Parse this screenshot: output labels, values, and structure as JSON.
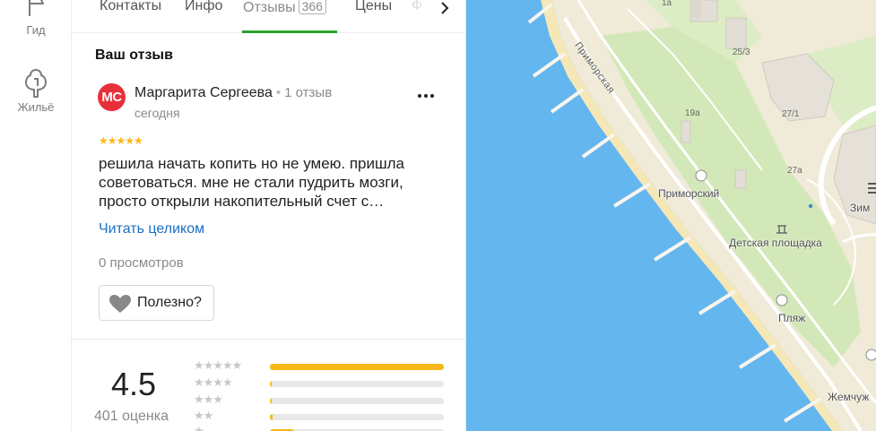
{
  "sidebar": {
    "guide_label": "Гид",
    "housing_label": "Жильё"
  },
  "tabs": [
    {
      "label": "Контакты"
    },
    {
      "label": "Инфо"
    },
    {
      "label": "Отзывы",
      "badge": "366",
      "active": true
    },
    {
      "label": "Цены"
    },
    {
      "label": "Ф"
    }
  ],
  "review": {
    "section_title": "Ваш отзыв",
    "avatar_initials": "МС",
    "author": "Маргарита Сергеева",
    "author_reviews": "1 отзыв",
    "date": "сегодня",
    "stars": "★★★★★",
    "text": "решила начать копить но не умею. пришла советоваться. мне не стали пудрить мозги, просто открыли накопительный счет с…",
    "read_full": "Читать целиком",
    "views": "0 просмотров",
    "useful_label": "Полезно?"
  },
  "rating": {
    "value": "4.5",
    "count": "401 оценка",
    "distribution": [
      {
        "stars": "★★★★★",
        "fraction": 1.0
      },
      {
        "stars": "★★★★",
        "fraction": 0.01
      },
      {
        "stars": "★★★",
        "fraction": 0.01
      },
      {
        "stars": "★★",
        "fraction": 0.015
      },
      {
        "stars": "★",
        "fraction": 0.14
      }
    ]
  },
  "map": {
    "street": "Приморская",
    "labels": {
      "primorsky": "Приморский",
      "playground": "Детская площадка",
      "beach": "Пляж",
      "zhemchuzh": "Жемчуж",
      "zim": "Зим"
    },
    "houses": {
      "h1a": "1а",
      "h25_3": "25/3",
      "h19a": "19а",
      "h27_1": "27/1",
      "h27a": "27а"
    }
  },
  "colors": {
    "accent_green": "#2ca02c",
    "link_blue": "#1a6fc4",
    "star_yellow": "#fdb813",
    "bar_yellow": "#f6b919",
    "avatar_red": "#e8303a",
    "water": "#64b6ee",
    "land": "#f0ead8",
    "park": "#d3e8b8"
  }
}
